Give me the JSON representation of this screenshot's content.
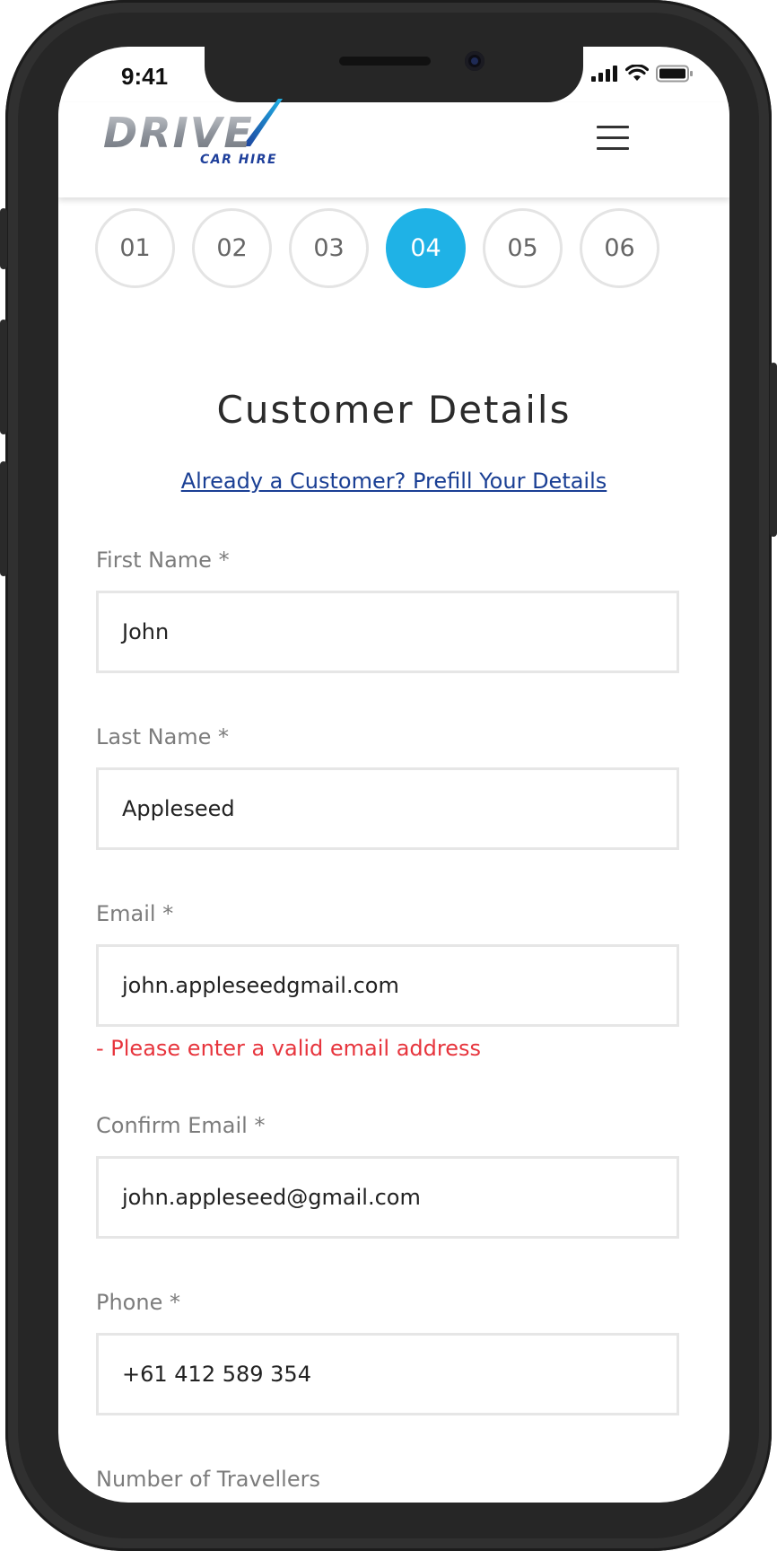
{
  "status_bar": {
    "time": "9:41"
  },
  "header": {
    "logo_main": "DRIVE",
    "logo_sub": "CAR HIRE",
    "menu_icon": "hamburger-menu-icon"
  },
  "steps": [
    {
      "label": "01",
      "active": false
    },
    {
      "label": "02",
      "active": false
    },
    {
      "label": "03",
      "active": false
    },
    {
      "label": "04",
      "active": true
    },
    {
      "label": "05",
      "active": false
    },
    {
      "label": "06",
      "active": false
    }
  ],
  "page": {
    "title": "Customer Details",
    "prefill_link": "Already a Customer? Prefill Your Details"
  },
  "form": {
    "first_name": {
      "label": "First Name *",
      "value": "John"
    },
    "last_name": {
      "label": "Last Name *",
      "value": "Appleseed"
    },
    "email": {
      "label": "Email *",
      "value": "john.appleseedgmail.com",
      "error": "- Please enter a valid email address"
    },
    "confirm_email": {
      "label": "Confirm Email *",
      "value": "john.appleseed@gmail.com"
    },
    "phone": {
      "label": "Phone *",
      "value": "+61 412 589 354"
    },
    "travellers": {
      "label": "Number of Travellers"
    }
  },
  "colors": {
    "accent": "#1fb2e6",
    "link": "#1a3f94",
    "error": "#e7353d"
  }
}
